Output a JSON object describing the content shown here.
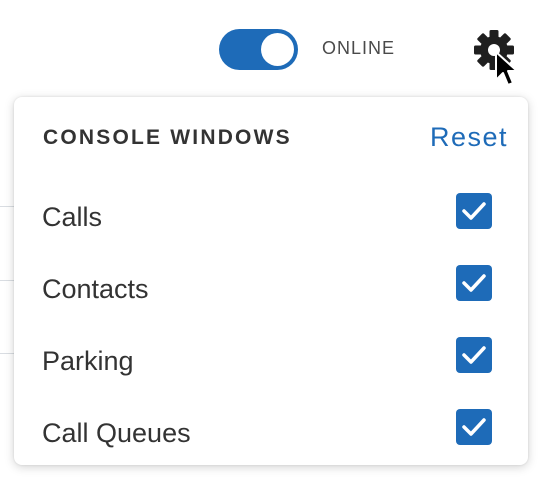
{
  "header": {
    "status_label": "ONLINE",
    "toggle_on": true,
    "settings_icon": "gear-icon"
  },
  "console_menu": {
    "title": "CONSOLE WINDOWS",
    "reset_label": "Reset",
    "items": [
      {
        "label": "Calls",
        "checked": true
      },
      {
        "label": "Contacts",
        "checked": true
      },
      {
        "label": "Parking",
        "checked": true
      },
      {
        "label": "Call Queues",
        "checked": true
      }
    ]
  },
  "colors": {
    "accent": "#1e6bb8",
    "text": "#333333"
  }
}
